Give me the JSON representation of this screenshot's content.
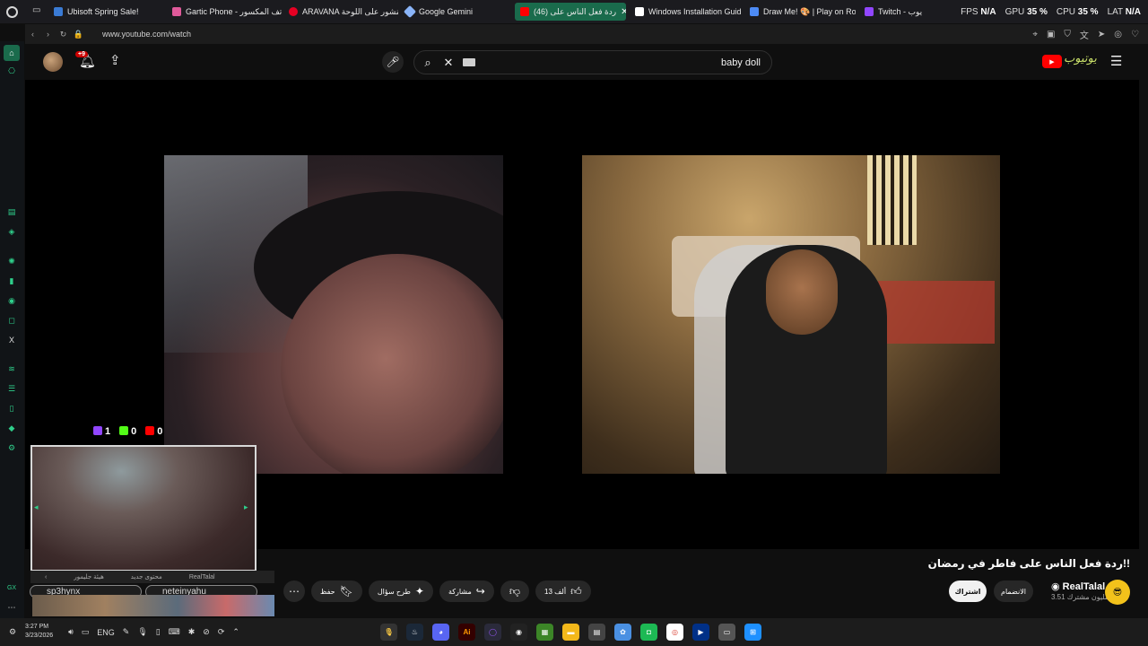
{
  "browser": {
    "tabs": [
      {
        "title": "Ubisoft Spring Sale!",
        "color": "#3a7bd5"
      },
      {
        "title": "Gartic Phone - هاتف المكسور",
        "color": "#e05a9a"
      },
      {
        "title": "ARAVANA منشور على اللوحة",
        "color": "#e60023"
      },
      {
        "title": "Google Gemini",
        "color": "#8ab4f8"
      },
      {
        "title": "(46) ردة فعل الناس على",
        "color": "#ff0000"
      },
      {
        "title": "Windows Installation Guide",
        "color": "#ffffff"
      },
      {
        "title": "Draw Me! 🎨 | Play on Rob",
        "color": "#4d8bf5"
      },
      {
        "title": "Twitch - يوب",
        "color": "#9146ff"
      }
    ],
    "stats": {
      "fps_label": "FPS",
      "fps_value": "N/A",
      "gpu_label": "GPU",
      "gpu_value": "35 %",
      "cpu_label": "CPU",
      "cpu_value": "35 %",
      "lat_label": "LAT",
      "lat_value": "N/A"
    },
    "url": "www.youtube.com/watch"
  },
  "youtube": {
    "notification_badge": "+9",
    "search_query": "baby doll",
    "logo_text": "يوتيوب"
  },
  "overlay_counters": {
    "twitch": "1",
    "kick": "0",
    "youtube": "0"
  },
  "chat": {
    "tabs": [
      "هيئة جليمور",
      "محتوى جديد",
      "RealTalal"
    ],
    "users": [
      "sp3hynx",
      "neteinyahu"
    ]
  },
  "video": {
    "title": "ردة فعل الناس على فاطر في رمضان!!",
    "channel": "RealTalal",
    "subscribers": "3.51 مليون مشترك",
    "subscribe_label": "اشتراك",
    "join_label": "الانضمام",
    "likes": "13 ألف",
    "share_label": "مشاركة",
    "ask_label": "طرح سؤال",
    "save_label": "حفظ"
  },
  "taskbar": {
    "time": "3:27 PM",
    "date": "3/23/2026",
    "lang": "ENG"
  },
  "colors": {
    "accent": "#1a6b4c",
    "youtube_red": "#ff0000",
    "sidebar_icon": "#2fcf8b"
  }
}
